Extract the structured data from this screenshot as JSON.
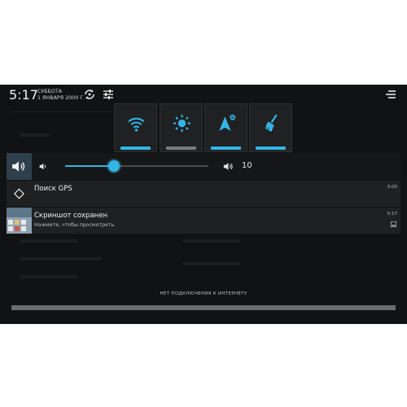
{
  "status_bar": {
    "time": "5:17",
    "day": "СУББОТА",
    "date": "1 ЯНВАРЯ 2000 Г.",
    "icons": [
      "rotate-icon",
      "settings-sliders-icon",
      "menu-lines-icon"
    ]
  },
  "quick_tiles": [
    {
      "name": "wifi-tile",
      "icon": "wifi-icon",
      "bar_color": "#33b5e5"
    },
    {
      "name": "brightness-tile",
      "icon": "brightness-icon",
      "bar_color": "#7a7a7a"
    },
    {
      "name": "location-settings-tile",
      "icon": "location-arrow-gear-icon",
      "bar_color": "#33b5e5"
    },
    {
      "name": "clean-tile",
      "icon": "broom-icon",
      "bar_color": "#33b5e5"
    }
  ],
  "volume": {
    "value": "10",
    "level_fraction": 0.34
  },
  "notifications": [
    {
      "title": "Поиск GPS",
      "subtitle": "",
      "time": "3:00",
      "icon": "gps-icon"
    },
    {
      "title": "Скриншот сохранен",
      "subtitle": "Нажмите, чтобы просмотреть.",
      "time": "5:17",
      "icon": "screenshot-thumbnail"
    }
  ],
  "network_status": "НЕТ ПОДКЛЮЧЕНИЯ К ИНТЕРНЕТУ",
  "colors": {
    "accent": "#33b5e5",
    "panel": "#1e2022",
    "background": "#111213"
  }
}
